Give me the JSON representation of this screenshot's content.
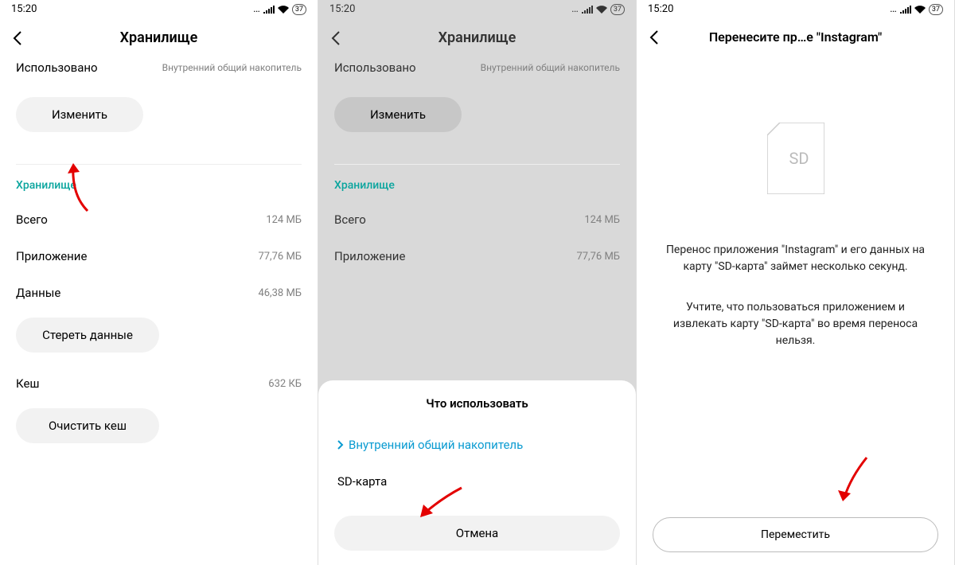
{
  "status": {
    "time": "15:20",
    "battery": "37"
  },
  "screen1": {
    "title": "Хранилище",
    "used_label": "Использовано",
    "used_value": "Внутренний общий накопитель",
    "change_btn": "Изменить",
    "section": "Хранилище",
    "rows": [
      {
        "k": "Всего",
        "v": "124 МБ"
      },
      {
        "k": "Приложение",
        "v": "77,76 МБ"
      },
      {
        "k": "Данные",
        "v": "46,38 МБ"
      }
    ],
    "clear_data": "Стереть данные",
    "cache_label": "Кеш",
    "cache_value": "632 КБ",
    "clear_cache": "Очистить кеш"
  },
  "screen2": {
    "title": "Хранилище",
    "used_label": "Использовано",
    "used_value": "Внутренний общий накопитель",
    "change_btn": "Изменить",
    "section": "Хранилище",
    "rows": [
      {
        "k": "Всего",
        "v": "124 МБ"
      },
      {
        "k": "Приложение",
        "v": "77,76 МБ"
      }
    ],
    "sheet_title": "Что использовать",
    "opt_internal": "Внутренний общий накопитель",
    "opt_sd": "SD-карта",
    "cancel": "Отмена"
  },
  "screen3": {
    "title": "Перенесите пр…е \"Instagram\"",
    "sd_label": "SD",
    "desc1": "Перенос приложения \"Instagram\" и его данных на карту \"SD-карта\" займет несколько секунд.",
    "desc2": "Учтите, что пользоваться приложением и извлекать карту \"SD-карта\" во время переноса нельзя.",
    "move_btn": "Переместить"
  }
}
